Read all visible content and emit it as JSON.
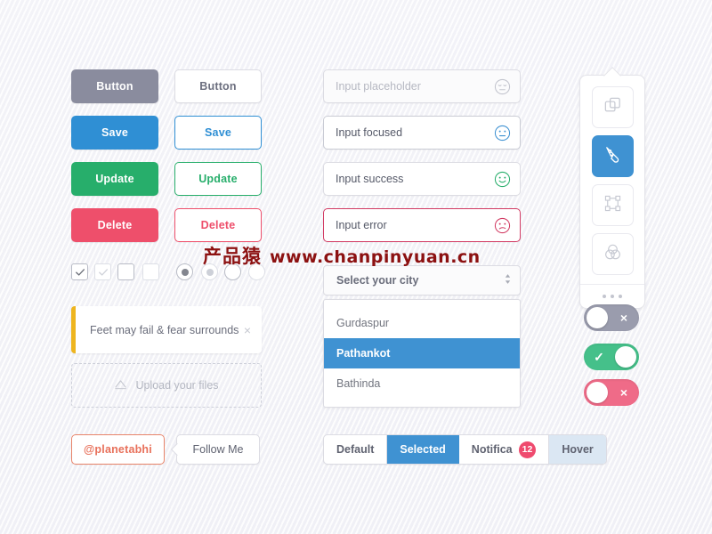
{
  "buttons": {
    "solid": [
      {
        "label": "Button",
        "variant": "disabled"
      },
      {
        "label": "Save",
        "variant": "blue"
      },
      {
        "label": "Update",
        "variant": "green"
      },
      {
        "label": "Delete",
        "variant": "red"
      }
    ],
    "ghost": [
      {
        "label": "Button",
        "variant": "disabled"
      },
      {
        "label": "Save",
        "variant": "blue"
      },
      {
        "label": "Update",
        "variant": "green"
      },
      {
        "label": "Delete",
        "variant": "red"
      }
    ]
  },
  "inputs": [
    {
      "value": "",
      "placeholder": "Input placeholder",
      "state": "placeholder",
      "icon": "sleepy-face-icon"
    },
    {
      "value": "Input focused",
      "placeholder": "",
      "state": "focused",
      "icon": "neutral-face-icon"
    },
    {
      "value": "Input success",
      "placeholder": "",
      "state": "success",
      "icon": "smiling-face-icon"
    },
    {
      "value": "Input error",
      "placeholder": "",
      "state": "error",
      "icon": "frowning-face-icon"
    }
  ],
  "checkboxes": [
    {
      "checked": true,
      "disabled": false
    },
    {
      "checked": true,
      "disabled": true
    },
    {
      "checked": false,
      "disabled": false
    },
    {
      "checked": false,
      "disabled": true
    }
  ],
  "radios": [
    {
      "selected": true,
      "disabled": false
    },
    {
      "selected": true,
      "disabled": true
    },
    {
      "selected": false,
      "disabled": false
    },
    {
      "selected": false,
      "disabled": true
    }
  ],
  "alert": {
    "message": "Feet may fail & fear surrounds",
    "close_label": "×",
    "accent_color": "#eeb51f"
  },
  "upload": {
    "label": "Upload your files",
    "icon": "upload-cloud-icon"
  },
  "select": {
    "label": "Select your city",
    "options": [
      {
        "label": "Gurdaspur",
        "selected": false
      },
      {
        "label": "Pathankot",
        "selected": true
      },
      {
        "label": "Bathinda",
        "selected": false
      }
    ]
  },
  "social": {
    "handle": "@planetabhi",
    "follow": "Follow Me"
  },
  "tabs": [
    {
      "label": "Default",
      "state": "default",
      "badge": null
    },
    {
      "label": "Selected",
      "state": "selected",
      "badge": null
    },
    {
      "label": "Notifica",
      "state": "default",
      "badge": "12"
    },
    {
      "label": "Hover",
      "state": "hover",
      "badge": null
    }
  ],
  "toolbar": {
    "tools": [
      {
        "icon": "copy-layers-icon",
        "active": false
      },
      {
        "icon": "pen-tool-icon",
        "active": true
      },
      {
        "icon": "transform-box-icon",
        "active": false
      },
      {
        "icon": "color-blend-circles-icon",
        "active": false
      }
    ],
    "more_icon": "more-dots-icon"
  },
  "toggles": [
    {
      "state": "off",
      "mark": "×",
      "style": "neutral"
    },
    {
      "state": "on",
      "mark": "✓",
      "style": "success"
    },
    {
      "state": "off",
      "mark": "×",
      "style": "danger"
    }
  ],
  "watermark": {
    "cn": "产品猿",
    "url": "www.chanpinyuan.cn",
    "color": "#8c1111"
  },
  "colors": {
    "blue": "#2f8fd4",
    "green": "#27ae6b",
    "red": "#ee4f6b",
    "gray": "#8a8c9e",
    "yellow": "#eeb51f",
    "background": "#f7f7fa"
  }
}
